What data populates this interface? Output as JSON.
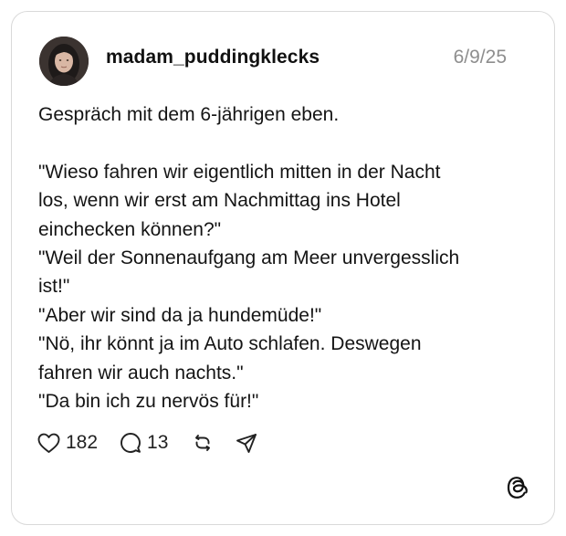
{
  "post": {
    "username": "madam_puddingklecks",
    "date": "6/9/25",
    "lines": [
      "Gespräch mit dem 6-jährigen eben.",
      "",
      "\"Wieso fahren wir eigentlich mitten in der Nacht",
      "los, wenn wir erst am Nachmittag ins Hotel",
      "einchecken können?\"",
      "\"Weil der Sonnenaufgang am Meer unvergesslich",
      "ist!\"",
      "\"Aber wir sind da ja hundemüde!\"",
      "\"Nö, ihr könnt ja im Auto schlafen. Deswegen",
      "fahren wir auch nachts.\"",
      "\"Da bin ich zu nervös für!\""
    ]
  },
  "actions": {
    "likes": "182",
    "replies": "13",
    "icons": [
      "heart-icon",
      "comment-icon",
      "repost-icon",
      "share-icon"
    ]
  },
  "brand": {
    "logo": "threads-logo-icon"
  },
  "colors": {
    "text": "#111111",
    "muted": "#8e8e8e",
    "border": "#d9d9d9"
  }
}
